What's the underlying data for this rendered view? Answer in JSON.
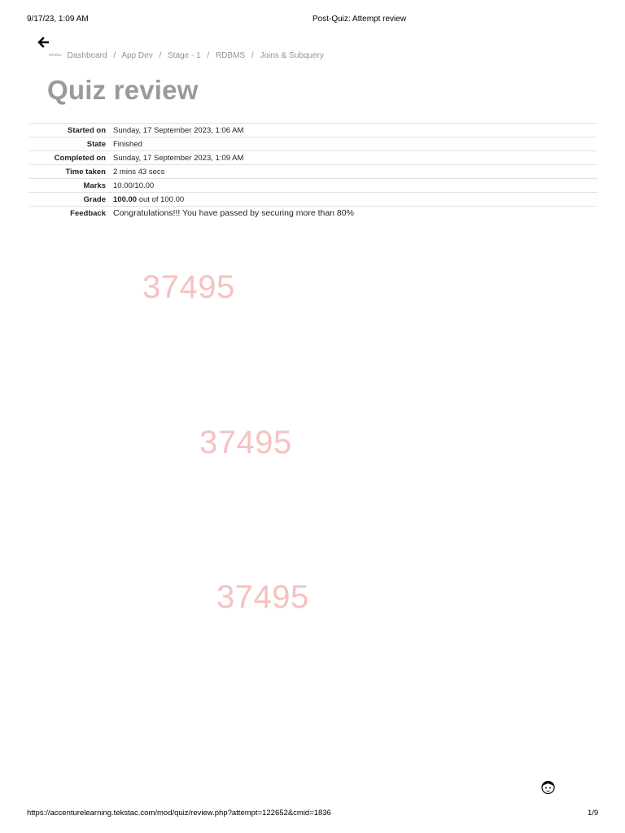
{
  "print_header": {
    "date": "9/17/23, 1:09 AM",
    "title": "Post-Quiz: Attempt review"
  },
  "back_link": {
    "icon": "arrow-left-icon"
  },
  "breadcrumb": {
    "home_icon_text": "tekstac",
    "items": [
      "Dashboard",
      "App Dev",
      "Stage - 1",
      "RDBMS",
      "Joins & Subquery"
    ],
    "separator": "/"
  },
  "page_title": "Quiz review",
  "summary": [
    {
      "label": "Started on",
      "value": "Sunday, 17 September 2023, 1:06 AM"
    },
    {
      "label": "State",
      "value": "Finished"
    },
    {
      "label": "Completed on",
      "value": "Sunday, 17 September 2023, 1:09 AM"
    },
    {
      "label": "Time taken",
      "value": "2 mins 43 secs"
    },
    {
      "label": "Marks",
      "value": "10.00/10.00"
    },
    {
      "label": "Grade",
      "value_bold": "100.00",
      "value": "out of 100.00"
    },
    {
      "label": "Feedback",
      "value": "Congratulations!!! You have passed by securing more than 80%"
    }
  ],
  "watermarks": [
    "37495",
    "37495",
    "37495"
  ],
  "print_footer": {
    "url": "https://accenturelearning.tekstac.com/mod/quiz/review.php?attempt=122652&cmid=1836",
    "page": "1/9"
  },
  "colors": {
    "title": "#9a9a9a",
    "watermark": "#f6c1c1",
    "breadcrumb": "#8d949b",
    "row_border": "#dee2e6"
  }
}
